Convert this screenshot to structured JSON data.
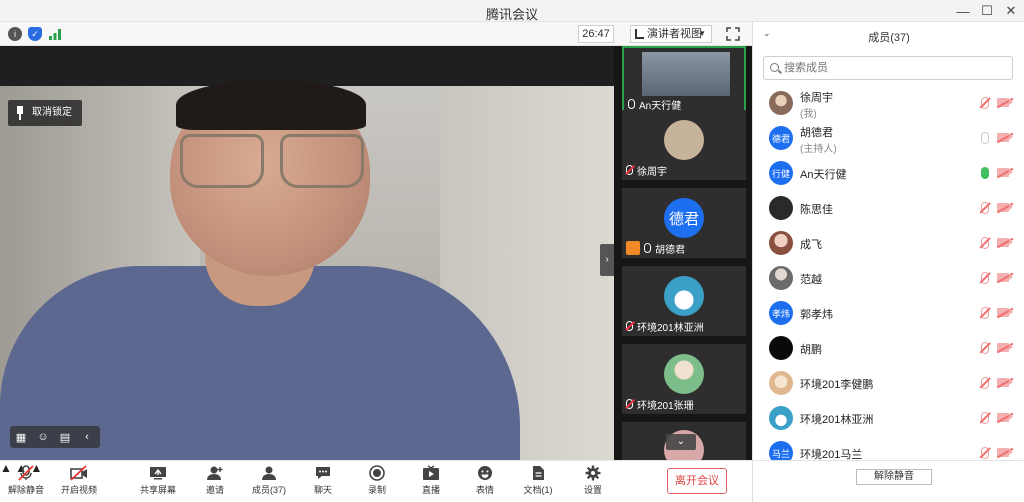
{
  "window": {
    "title": "腾讯会议",
    "minimize": "—",
    "maximize": "☐",
    "close": "✕"
  },
  "status": {
    "timer": "26:47",
    "view_mode": "演讲者视图"
  },
  "main_video": {
    "unpin_label": "取消锁定"
  },
  "thumbnails": [
    {
      "name": "An天行健",
      "avatar_text": "",
      "color": "#7a8a96",
      "muted": false,
      "host": false,
      "active": true
    },
    {
      "name": "徐周宇",
      "avatar_text": "",
      "color": "#c6b49a",
      "muted": true,
      "host": false,
      "active": false
    },
    {
      "name": "胡德君",
      "avatar_text": "德君",
      "color": "#1e6ff0",
      "muted": false,
      "host": true,
      "active": false
    },
    {
      "name": "环境201林亚洲",
      "avatar_text": "",
      "color": "#3aa0c8",
      "muted": true,
      "host": false,
      "active": false
    },
    {
      "name": "环境201张珊",
      "avatar_text": "",
      "color": "#7dbd8a",
      "muted": true,
      "host": false,
      "active": false
    },
    {
      "name": "",
      "avatar_text": "",
      "color": "#d8a8a8",
      "muted": true,
      "host": false,
      "active": false
    }
  ],
  "panel": {
    "title": "成员(37)",
    "search_placeholder": "搜索成员",
    "unmute_all": "解除静音",
    "members": [
      {
        "name": "徐周宇",
        "sub": "(我)",
        "avatar_text": "",
        "color": "#8a6a5a",
        "mic": "muted"
      },
      {
        "name": "胡德君",
        "sub": "(主持人)",
        "avatar_text": "德君",
        "color": "#1e6ff0",
        "mic": "grey"
      },
      {
        "name": "An天行健",
        "sub": "",
        "avatar_text": "行健",
        "color": "#1e6ff0",
        "mic": "on"
      },
      {
        "name": "陈思佳",
        "sub": "",
        "avatar_text": "",
        "color": "#2a2a2a",
        "mic": "muted"
      },
      {
        "name": "成飞",
        "sub": "",
        "avatar_text": "",
        "color": "#c98a7a",
        "mic": "muted"
      },
      {
        "name": "范越",
        "sub": "",
        "avatar_text": "",
        "color": "#6a6a6a",
        "mic": "muted"
      },
      {
        "name": "郭孝炜",
        "sub": "",
        "avatar_text": "孝炜",
        "color": "#1e6ff0",
        "mic": "muted"
      },
      {
        "name": "胡鹏",
        "sub": "",
        "avatar_text": "",
        "color": "#0a0a0a",
        "mic": "muted"
      },
      {
        "name": "环境201李健鹏",
        "sub": "",
        "avatar_text": "",
        "color": "#e0b890",
        "mic": "muted"
      },
      {
        "name": "环境201林亚洲",
        "sub": "",
        "avatar_text": "",
        "color": "#3aa0c8",
        "mic": "muted"
      },
      {
        "name": "环境201马兰",
        "sub": "",
        "avatar_text": "马兰",
        "color": "#1e6ff0",
        "mic": "muted"
      }
    ]
  },
  "toolbar": {
    "unmute": "解除静音",
    "start_video": "开启视频",
    "share_screen": "共享屏幕",
    "invite": "邀请",
    "members": "成员(37)",
    "chat": "聊天",
    "record": "录制",
    "live": "直播",
    "reactions": "表情",
    "docs": "文档(1)",
    "settings": "设置",
    "leave": "离开会议"
  }
}
